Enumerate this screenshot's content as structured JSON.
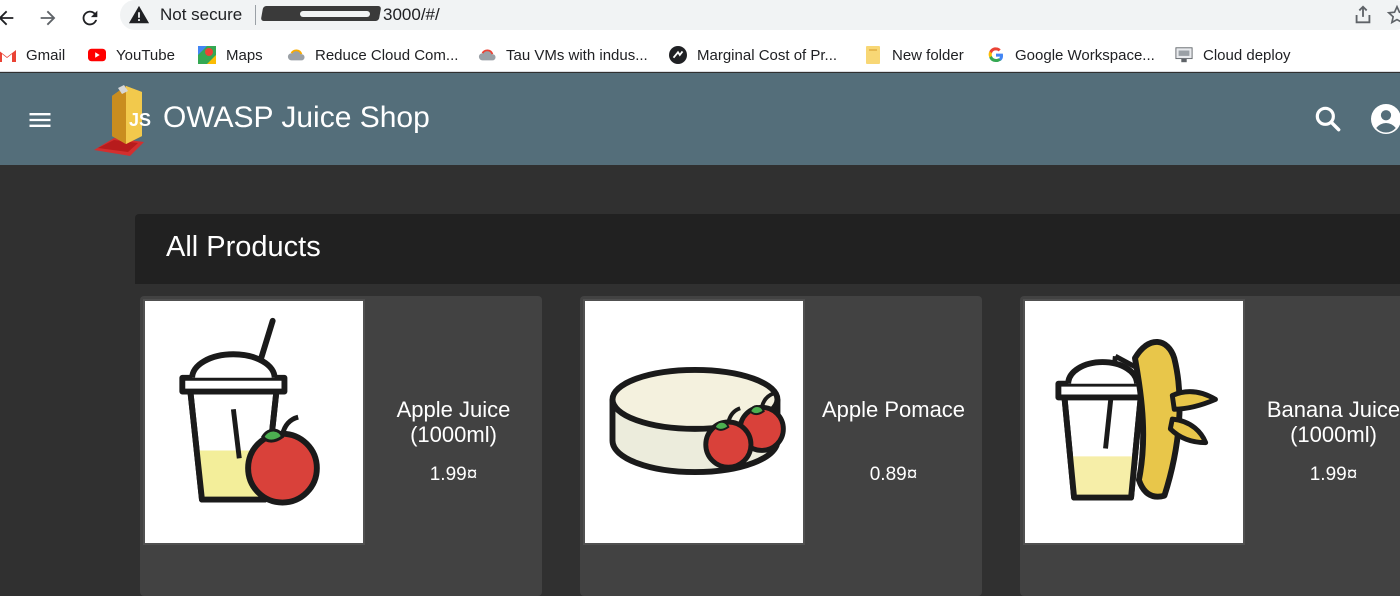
{
  "browser": {
    "security_label": "Not secure",
    "url": "3000/#/",
    "bookmarks": [
      {
        "label": "Gmail",
        "icon": "gmail-icon"
      },
      {
        "label": "YouTube",
        "icon": "youtube-icon"
      },
      {
        "label": "Maps",
        "icon": "maps-icon"
      },
      {
        "label": "Reduce Cloud Com...",
        "icon": "cloud-icon"
      },
      {
        "label": "Tau VMs with indus...",
        "icon": "cloud-icon"
      },
      {
        "label": "Marginal Cost of Pr...",
        "icon": "site-icon"
      },
      {
        "label": "New folder",
        "icon": "folder-icon"
      },
      {
        "label": "Google Workspace...",
        "icon": "google-icon"
      },
      {
        "label": "Cloud deploy",
        "icon": "deploy-icon"
      }
    ]
  },
  "toolbar": {
    "title": "OWASP Juice Shop",
    "color": "#546e7a"
  },
  "main": {
    "heading": "All Products",
    "products": [
      {
        "name": "Apple Juice (1000ml)",
        "price": "1.99¤"
      },
      {
        "name": "Apple Pomace",
        "price": "0.89¤"
      },
      {
        "name": "Banana Juice (1000ml)",
        "price": "1.99¤"
      }
    ]
  }
}
